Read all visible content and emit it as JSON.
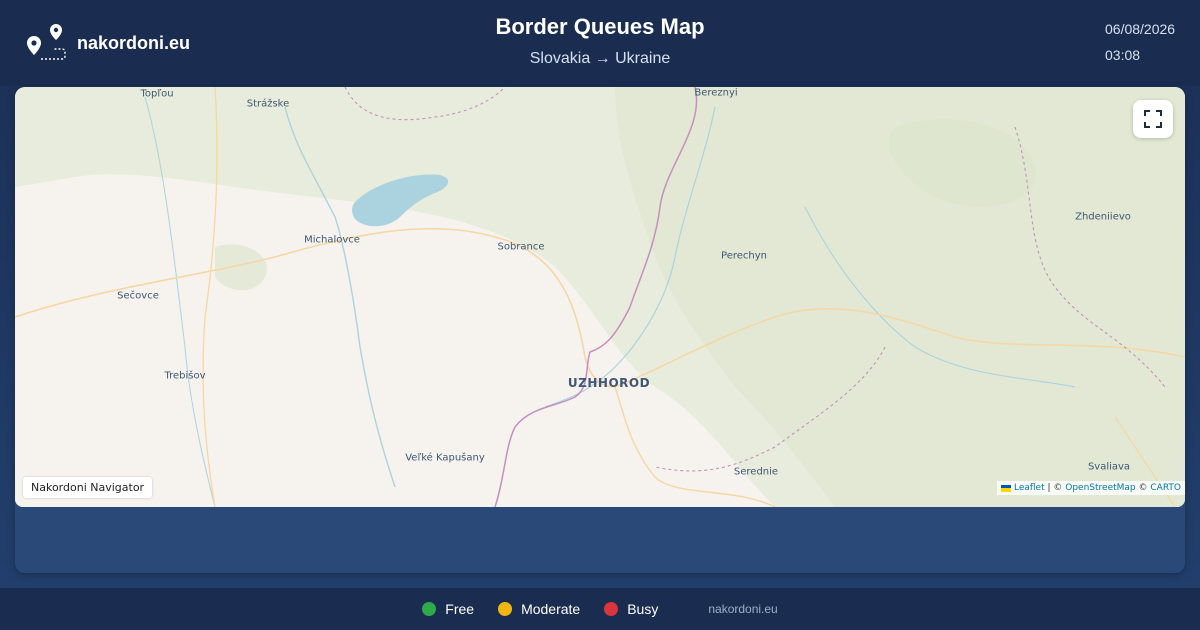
{
  "brand": {
    "name": "nakordoni.eu",
    "icon": "map-pins-route-icon"
  },
  "header": {
    "title": "Border Queues Map",
    "subtitle": "Slovakia → Ukraine",
    "date": "06/08/2026",
    "time": "03:08"
  },
  "map": {
    "places": [
      {
        "name": "Topľou",
        "type": "town"
      },
      {
        "name": "Strážske",
        "type": "town"
      },
      {
        "name": "Bereznyi",
        "type": "town"
      },
      {
        "name": "Michalovce",
        "type": "town"
      },
      {
        "name": "Sobrance",
        "type": "town"
      },
      {
        "name": "Perechyn",
        "type": "town"
      },
      {
        "name": "Zhdeniievo",
        "type": "town"
      },
      {
        "name": "Sečovce",
        "type": "town"
      },
      {
        "name": "Trebišov",
        "type": "town"
      },
      {
        "name": "UZHHOROD",
        "type": "city"
      },
      {
        "name": "Veľké Kapušany",
        "type": "town"
      },
      {
        "name": "Serednie",
        "type": "town"
      },
      {
        "name": "Svaliava",
        "type": "town"
      }
    ],
    "fullscreen_icon": "fullscreen-icon",
    "navigator_label": "Nakordoni Navigator",
    "attribution": {
      "leaflet": "Leaflet",
      "sep1": " | © ",
      "osm": "OpenStreetMap",
      "sep2": " © ",
      "carto": "CARTO"
    },
    "colors": {
      "land": "#f6f3ee",
      "forest": "#e4ead8",
      "water": "#aad3df",
      "border": "#c68fbf"
    }
  },
  "legend": [
    {
      "label": "Free",
      "color": "#2faa4a"
    },
    {
      "label": "Moderate",
      "color": "#f2b70f"
    },
    {
      "label": "Busy",
      "color": "#d9363e"
    }
  ],
  "footer": {
    "site": "nakordoni.eu"
  }
}
